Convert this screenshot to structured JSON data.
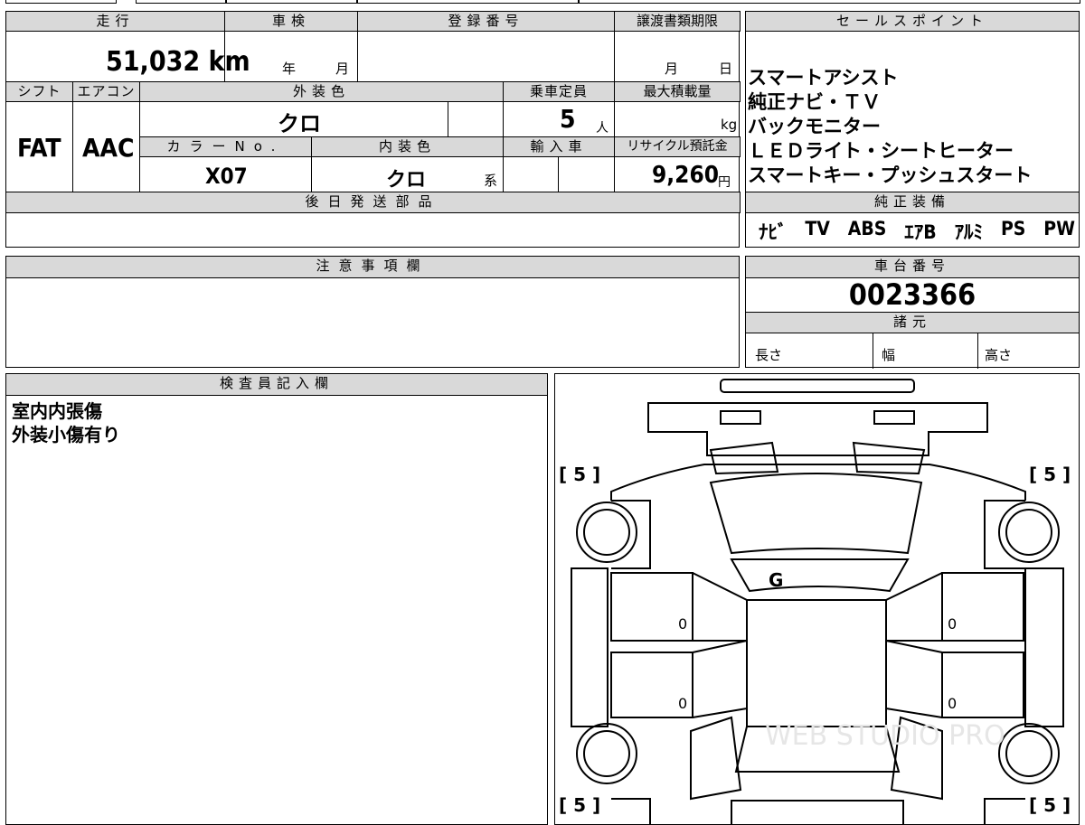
{
  "top_table": {
    "mileage_label": "走行",
    "inspection_label": "車検",
    "registration_label": "登録番号",
    "transfer_deadline_label": "譲渡書類期限",
    "mileage_value": "51,032",
    "mileage_unit": "km",
    "year_unit": "年",
    "month_unit": "月",
    "deadline_month": "月",
    "deadline_day": "日",
    "shift_label": "シフト",
    "aircon_label": "エアコン",
    "exterior_color_label": "外装色",
    "capacity_label": "乗車定員",
    "max_load_label": "最大積載量",
    "shift_value": "FAT",
    "aircon_value": "AAC",
    "exterior_color_value": "クロ",
    "capacity_value": "5",
    "capacity_unit": "人",
    "max_load_unit": "kg",
    "color_no_label": "カラーNo.",
    "interior_color_label": "内装色",
    "import_label": "輸入車",
    "recycle_label": "リサイクル預託金",
    "color_no_value": "X07",
    "interior_color_value": "クロ",
    "interior_color_suffix": "系",
    "recycle_value": "9,260",
    "recycle_unit": "円",
    "parts_label": "後日発送部品",
    "parts_value": ""
  },
  "sales_points": {
    "label": "セールスポイント",
    "lines": [
      "スマートアシスト",
      "純正ナビ・ＴＶ",
      "バックモニター",
      "ＬＥＤライト・シートヒーター",
      "スマートキー・プッシュスタート"
    ]
  },
  "genuine_equipment": {
    "label": "純正装備",
    "items": [
      "ﾅﾋﾞ",
      "TV",
      "ABS",
      "ｴｱB",
      "ｱﾙﾐ",
      "PS",
      "PW"
    ]
  },
  "notes": {
    "label": "注意事項欄",
    "value": ""
  },
  "chassis": {
    "label": "車台番号",
    "value": "0023366",
    "specs_label": "諸元",
    "length_label": "長さ",
    "width_label": "幅",
    "height_label": "高さ"
  },
  "inspector": {
    "label": "検査員記入欄",
    "lines": [
      "室内内張傷",
      "外装小傷有り"
    ]
  },
  "diagram": {
    "tire_front_left": "[ 5 ]",
    "tire_front_right": "[ 5 ]",
    "tire_rear_left": "[ 5 ]",
    "tire_rear_right": "[ 5 ]",
    "glass_mark": "G",
    "door_mark_fl": "0",
    "door_mark_fr": "0",
    "door_mark_rl": "0",
    "door_mark_rr": "0",
    "watermark": "WEB STUDIO PRO"
  },
  "colors": {
    "header_bg": "#d9d9d9",
    "line": "#000000"
  }
}
